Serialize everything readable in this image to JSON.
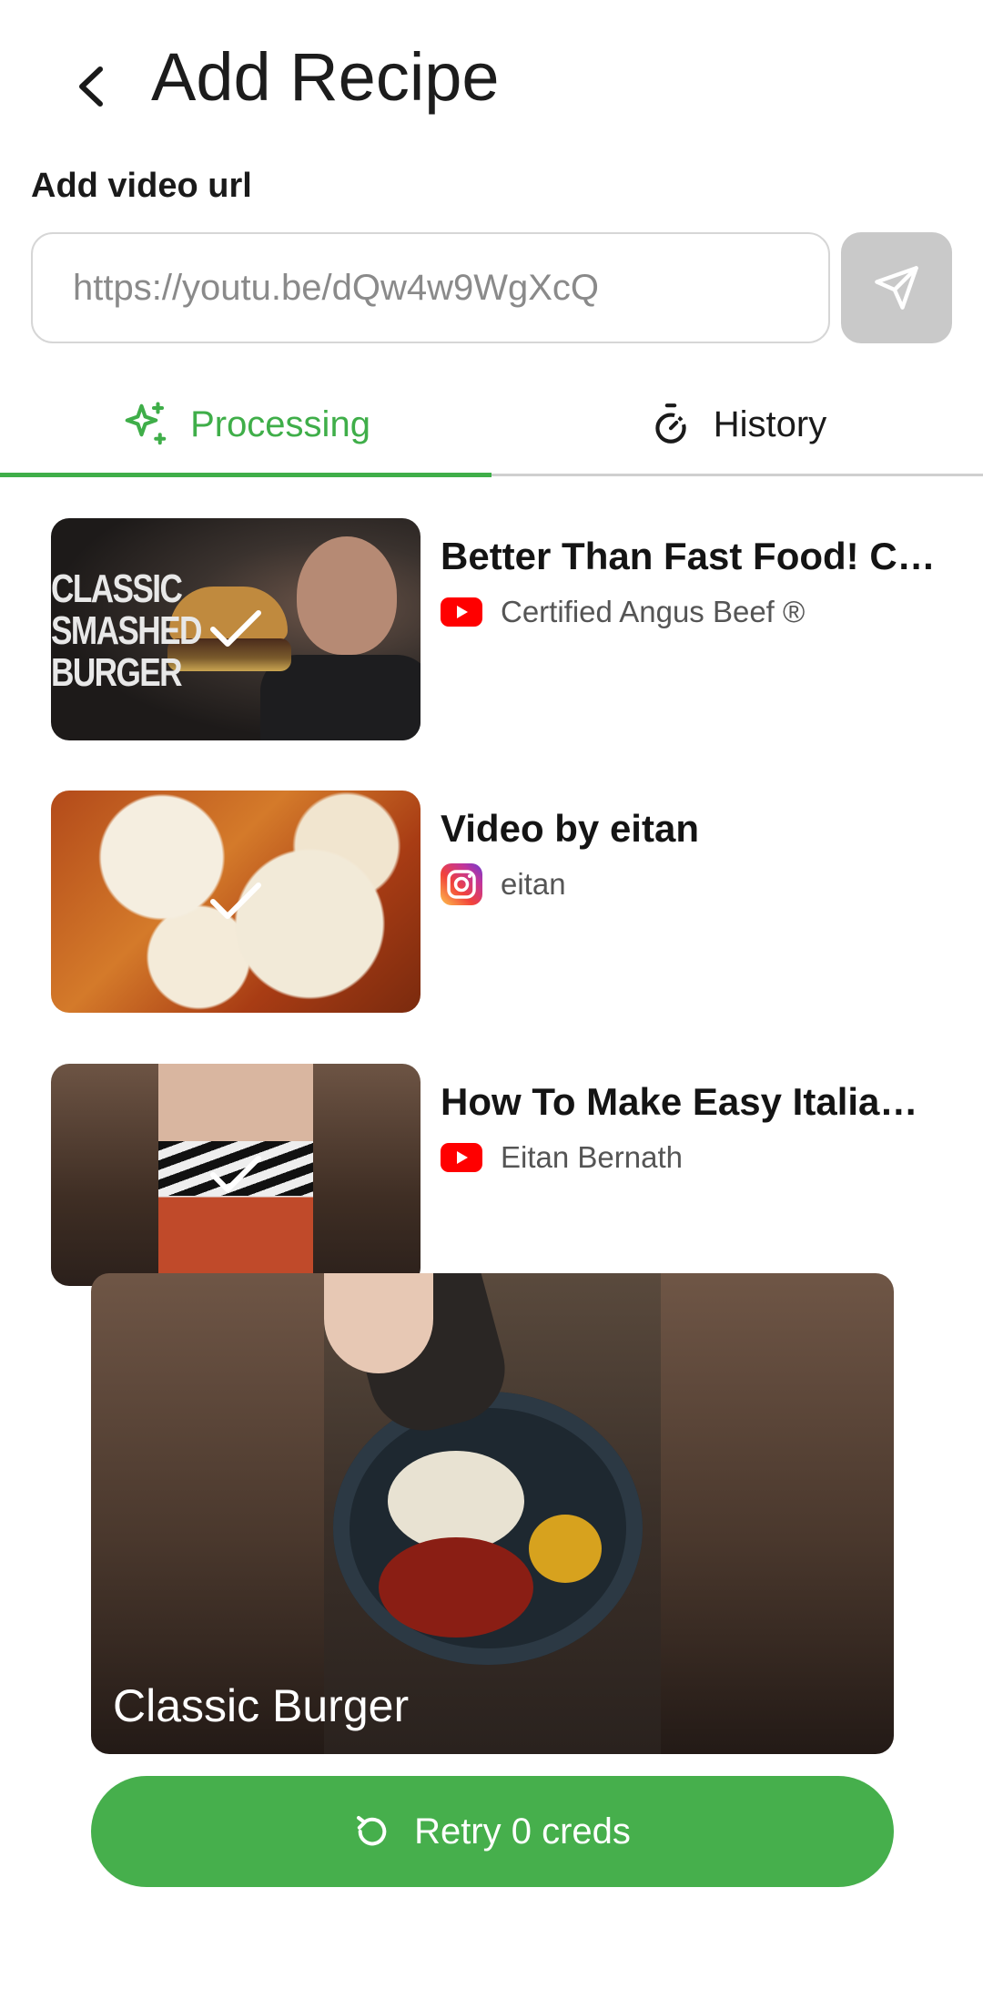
{
  "header": {
    "title": "Add Recipe"
  },
  "url_section": {
    "label": "Add video url",
    "placeholder": "https://youtu.be/dQw4w9WgXcQ"
  },
  "tabs": [
    {
      "label": "Processing",
      "active": true
    },
    {
      "label": "History",
      "active": false
    }
  ],
  "colors": {
    "accent": "#3fae49",
    "send_button_disabled": "#c9c9c9",
    "youtube": "#ff0000"
  },
  "recipes": [
    {
      "title": "Better Than Fast Food! Cl…",
      "source_icon": "youtube-icon",
      "source": "Certified Angus Beef ®",
      "thumb_overlay_text": "CLASSIC SMASHED BURGER",
      "status": "check-icon"
    },
    {
      "title": "Video by eitan",
      "source_icon": "instagram-icon",
      "source": "eitan",
      "status": "check-icon"
    },
    {
      "title": "How To Make Easy Italia…",
      "source_icon": "youtube-icon",
      "source": "Eitan Bernath",
      "status": "check-icon"
    }
  ],
  "preview": {
    "title": "Classic Burger"
  },
  "retry_button": {
    "label": "Retry 0 creds",
    "icon": "retry-icon"
  }
}
